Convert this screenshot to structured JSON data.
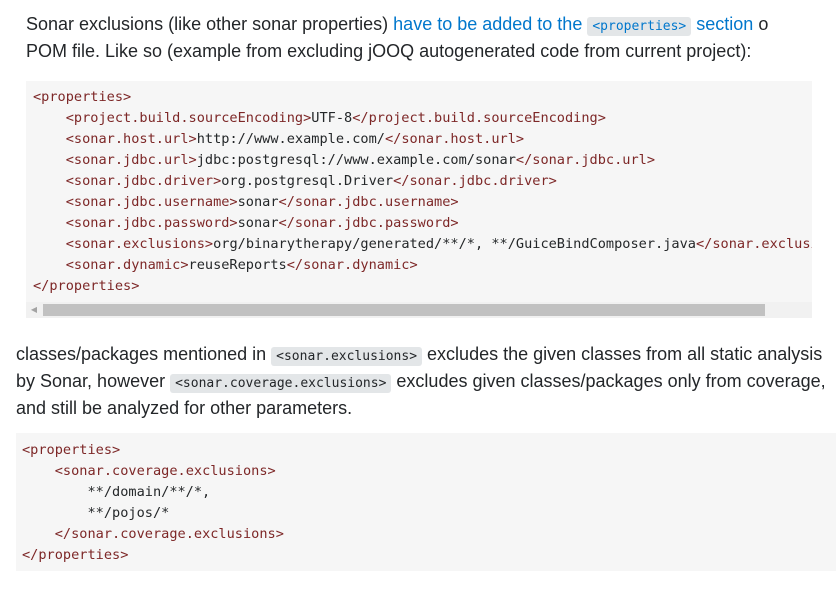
{
  "para1": {
    "pre": "Sonar exclusions (like other sonar properties) ",
    "link_text": "have to be added to the ",
    "link_code": "<properties>",
    "link_tail": " section",
    "after_link": " o",
    "line2": "POM file. Like so (example from excluding jOOQ autogenerated code from current project):"
  },
  "code1": {
    "lines": [
      "<properties>",
      "    <project.build.sourceEncoding>UTF-8</project.build.sourceEncoding>",
      "    <sonar.host.url>http://www.example.com/</sonar.host.url>",
      "    <sonar.jdbc.url>jdbc:postgresql://www.example.com/sonar</sonar.jdbc.url>",
      "    <sonar.jdbc.driver>org.postgresql.Driver</sonar.jdbc.driver>",
      "    <sonar.jdbc.username>sonar</sonar.jdbc.username>",
      "    <sonar.jdbc.password>sonar</sonar.jdbc.password>",
      "    <sonar.exclusions>org/binarytherapy/generated/**/*, **/GuiceBindComposer.java</sonar.exclusions>",
      "    <sonar.dynamic>reuseReports</sonar.dynamic>",
      "</properties>"
    ]
  },
  "para2": {
    "t1": "classes/packages mentioned in ",
    "c1": "<sonar.exclusions>",
    "t2": " excludes the given classes from all static analysis by Sonar, however ",
    "c2": "<sonar.coverage.exclusions>",
    "t3": " excludes given classes/packages only from coverage, and still be analyzed for other parameters."
  },
  "code2": {
    "lines": [
      "<properties>",
      "    <sonar.coverage.exclusions>",
      "        **/domain/**/*,",
      "        **/pojos/*",
      "    </sonar.coverage.exclusions>",
      "</properties>"
    ]
  },
  "colors": {
    "tag": "#7d2727",
    "text": "#242729",
    "link": "#0077cc",
    "code_bg": "#f6f6f6",
    "inline_code_bg": "#e3e6e8"
  },
  "icons": {
    "scroll_left": "triangle-left-icon"
  }
}
